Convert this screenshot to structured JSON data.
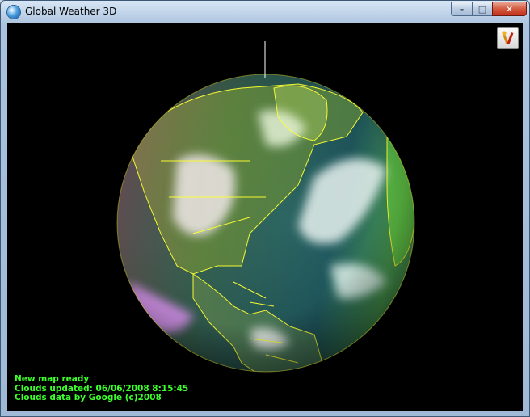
{
  "window": {
    "title": "Global Weather 3D",
    "icon": "globe-app-icon",
    "controls": {
      "minimize": "–",
      "maximize": "□",
      "close": "✕"
    }
  },
  "toolbar": {
    "tools_icon": "tools-icon"
  },
  "globe": {
    "center_region": "North America and North Atlantic",
    "overlay_color": "#ffff33"
  },
  "status": {
    "line1": "New map ready",
    "line2": "Clouds updated: 06/06/2008 8:15:45",
    "line3": "Clouds data by Google (c)2008",
    "color": "#3dff2d"
  }
}
